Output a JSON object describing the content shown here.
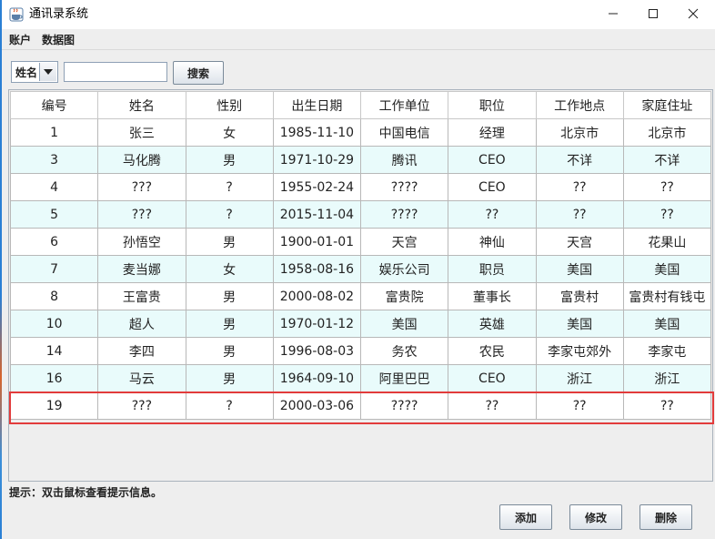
{
  "window": {
    "title": "通讯录系统"
  },
  "menu": [
    "账户",
    "数据图"
  ],
  "search": {
    "field_selected": "姓名",
    "value": "",
    "button": "搜索"
  },
  "table": {
    "columns": [
      "编号",
      "姓名",
      "性别",
      "出生日期",
      "工作单位",
      "职位",
      "工作地点",
      "家庭住址"
    ],
    "rows": [
      [
        "1",
        "张三",
        "女",
        "1985-11-10",
        "中国电信",
        "经理",
        "北京市",
        "北京市"
      ],
      [
        "3",
        "马化腾",
        "男",
        "1971-10-29",
        "腾讯",
        "CEO",
        "不详",
        "不详"
      ],
      [
        "4",
        "???",
        "?",
        "1955-02-24",
        "????",
        "CEO",
        "??",
        "??"
      ],
      [
        "5",
        "???",
        "?",
        "2015-11-04",
        "????",
        "??",
        "??",
        "??"
      ],
      [
        "6",
        "孙悟空",
        "男",
        "1900-01-01",
        "天宫",
        "神仙",
        "天宫",
        "花果山"
      ],
      [
        "7",
        "麦当娜",
        "女",
        "1958-08-16",
        "娱乐公司",
        "职员",
        "美国",
        "美国"
      ],
      [
        "8",
        "王富贵",
        "男",
        "2000-08-02",
        "富贵院",
        "董事长",
        "富贵村",
        "富贵村有钱屯"
      ],
      [
        "10",
        "超人",
        "男",
        "1970-01-12",
        "美国",
        "英雄",
        "美国",
        "美国"
      ],
      [
        "14",
        "李四",
        "男",
        "1996-08-03",
        "务农",
        "农民",
        "李家屯郊外",
        "李家屯"
      ],
      [
        "16",
        "马云",
        "男",
        "1964-09-10",
        "阿里巴巴",
        "CEO",
        "浙江",
        "浙江"
      ],
      [
        "19",
        "???",
        "?",
        "2000-03-06",
        "????",
        "??",
        "??",
        "??"
      ]
    ]
  },
  "hint": "提示：双击鼠标查看提示信息。",
  "buttons": {
    "add": "添加",
    "edit": "修改",
    "delete": "删除"
  },
  "colors": {
    "highlight": "#e23b3b",
    "stripe": "#e9fbfb"
  }
}
